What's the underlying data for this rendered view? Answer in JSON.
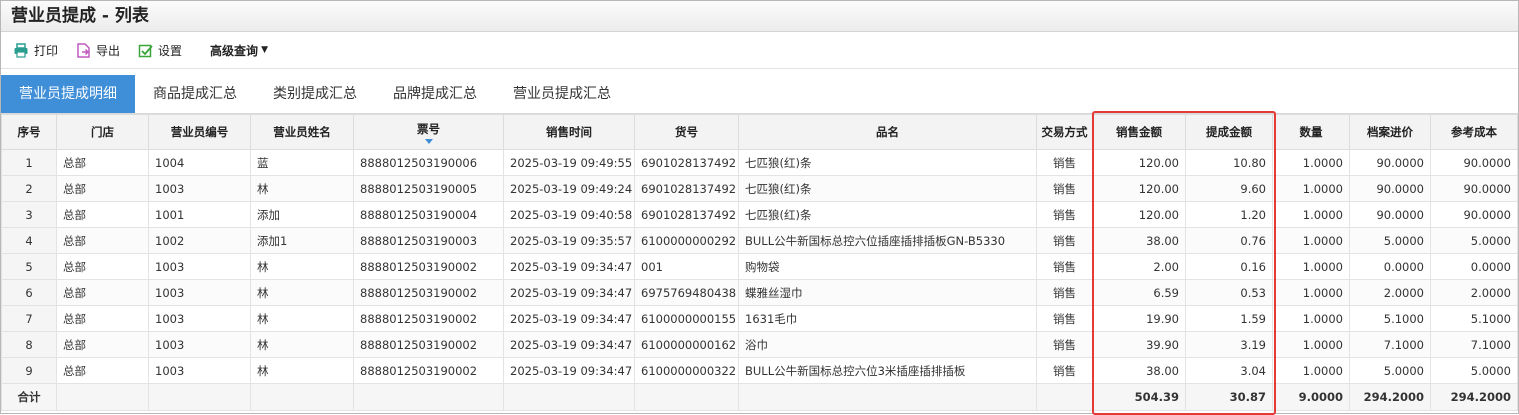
{
  "page": {
    "title": "营业员提成 - 列表"
  },
  "toolbar": {
    "print_label": "打印",
    "export_label": "导出",
    "settings_label": "设置",
    "advanced_label": "高级查询"
  },
  "tabs": [
    {
      "label": "营业员提成明细",
      "active": true
    },
    {
      "label": "商品提成汇总",
      "active": false
    },
    {
      "label": "类别提成汇总",
      "active": false
    },
    {
      "label": "品牌提成汇总",
      "active": false
    },
    {
      "label": "营业员提成汇总",
      "active": false
    }
  ],
  "table": {
    "columns": [
      "序号",
      "门店",
      "营业员编号",
      "营业员姓名",
      "票号",
      "销售时间",
      "货号",
      "品名",
      "交易方式",
      "销售金额",
      "提成金额",
      "数量",
      "档案进价",
      "参考成本"
    ],
    "sorted_column": "票号",
    "rows": [
      [
        "1",
        "总部",
        "1004",
        "蓝",
        "8888012503190006",
        "2025-03-19 09:49:55",
        "6901028137492",
        "七匹狼(红)条",
        "销售",
        "120.00",
        "10.80",
        "1.0000",
        "90.0000",
        "90.0000"
      ],
      [
        "2",
        "总部",
        "1003",
        "林",
        "8888012503190005",
        "2025-03-19 09:49:24",
        "6901028137492",
        "七匹狼(红)条",
        "销售",
        "120.00",
        "9.60",
        "1.0000",
        "90.0000",
        "90.0000"
      ],
      [
        "3",
        "总部",
        "1001",
        "添加",
        "8888012503190004",
        "2025-03-19 09:40:58",
        "6901028137492",
        "七匹狼(红)条",
        "销售",
        "120.00",
        "1.20",
        "1.0000",
        "90.0000",
        "90.0000"
      ],
      [
        "4",
        "总部",
        "1002",
        "添加1",
        "8888012503190003",
        "2025-03-19 09:35:57",
        "6100000000292",
        "BULL公牛新国标总控六位插座插排插板GN-B5330",
        "销售",
        "38.00",
        "0.76",
        "1.0000",
        "5.0000",
        "5.0000"
      ],
      [
        "5",
        "总部",
        "1003",
        "林",
        "8888012503190002",
        "2025-03-19 09:34:47",
        "001",
        "购物袋",
        "销售",
        "2.00",
        "0.16",
        "1.0000",
        "0.0000",
        "0.0000"
      ],
      [
        "6",
        "总部",
        "1003",
        "林",
        "8888012503190002",
        "2025-03-19 09:34:47",
        "6975769480438",
        "蝶雅丝湿巾",
        "销售",
        "6.59",
        "0.53",
        "1.0000",
        "2.0000",
        "2.0000"
      ],
      [
        "7",
        "总部",
        "1003",
        "林",
        "8888012503190002",
        "2025-03-19 09:34:47",
        "6100000000155",
        "1631毛巾",
        "销售",
        "19.90",
        "1.59",
        "1.0000",
        "5.1000",
        "5.1000"
      ],
      [
        "8",
        "总部",
        "1003",
        "林",
        "8888012503190002",
        "2025-03-19 09:34:47",
        "6100000000162",
        "浴巾",
        "销售",
        "39.90",
        "3.19",
        "1.0000",
        "7.1000",
        "7.1000"
      ],
      [
        "9",
        "总部",
        "1003",
        "林",
        "8888012503190002",
        "2025-03-19 09:34:47",
        "6100000000322",
        "BULL公牛新国标总控六位3米插座插排插板",
        "销售",
        "38.00",
        "3.04",
        "1.0000",
        "5.0000",
        "5.0000"
      ]
    ],
    "totals": {
      "label": "合计",
      "sales_amount": "504.39",
      "commission_amount": "30.87",
      "quantity": "9.0000",
      "archive_price": "294.2000",
      "reference_cost": "294.2000"
    }
  },
  "colors": {
    "accent": "#3f8ed8",
    "highlight": "#e53935"
  }
}
